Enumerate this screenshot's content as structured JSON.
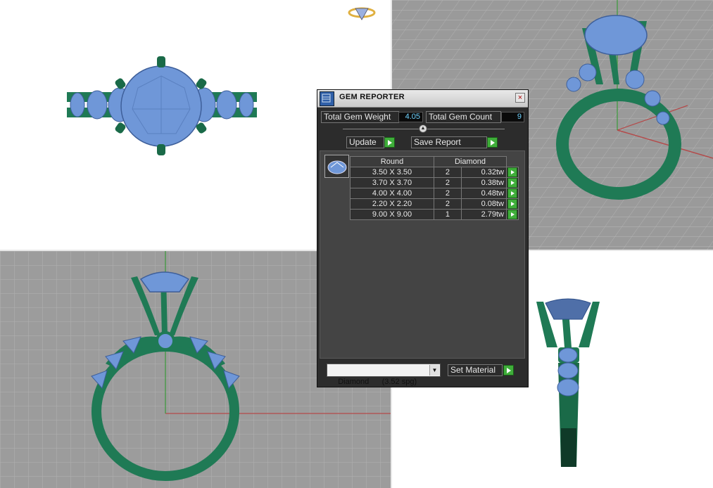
{
  "panel": {
    "title": "GEM REPORTER",
    "close_glyph": "×",
    "total_weight_label": "Total Gem Weight",
    "total_weight_value": "4.05",
    "total_count_label": "Total Gem Count",
    "total_count_value": "9",
    "update_label": "Update",
    "save_report_label": "Save Report",
    "collapse_glyph": "▲",
    "table": {
      "headers": [
        "Round",
        "Diamond"
      ],
      "rows": [
        {
          "size": "3.50 X 3.50",
          "count": "2",
          "weight": "0.32tw"
        },
        {
          "size": "3.70 X 3.70",
          "count": "2",
          "weight": "0.38tw"
        },
        {
          "size": "4.00 X 4.00",
          "count": "2",
          "weight": "0.48tw"
        },
        {
          "size": "2.20 X 2.20",
          "count": "2",
          "weight": "0.08tw"
        },
        {
          "size": "9.00 X 9.00",
          "count": "1",
          "weight": "2.79tw"
        }
      ]
    },
    "material": "Diamond      (3.52 spg)",
    "select_glyph": "▼",
    "set_material_label": "Set Material"
  },
  "colors": {
    "metal": "#1f7a55",
    "gem": "#6f97d8",
    "grid_bg": "#9c9c9c",
    "axis_red": "#b44a4a",
    "axis_green": "#3a9a3a"
  },
  "icons": [
    "gem-reporter-icon",
    "close-icon",
    "collapse-icon",
    "arrow-right-icon",
    "round-gem-icon",
    "dropdown-icon",
    "logo-icon"
  ]
}
